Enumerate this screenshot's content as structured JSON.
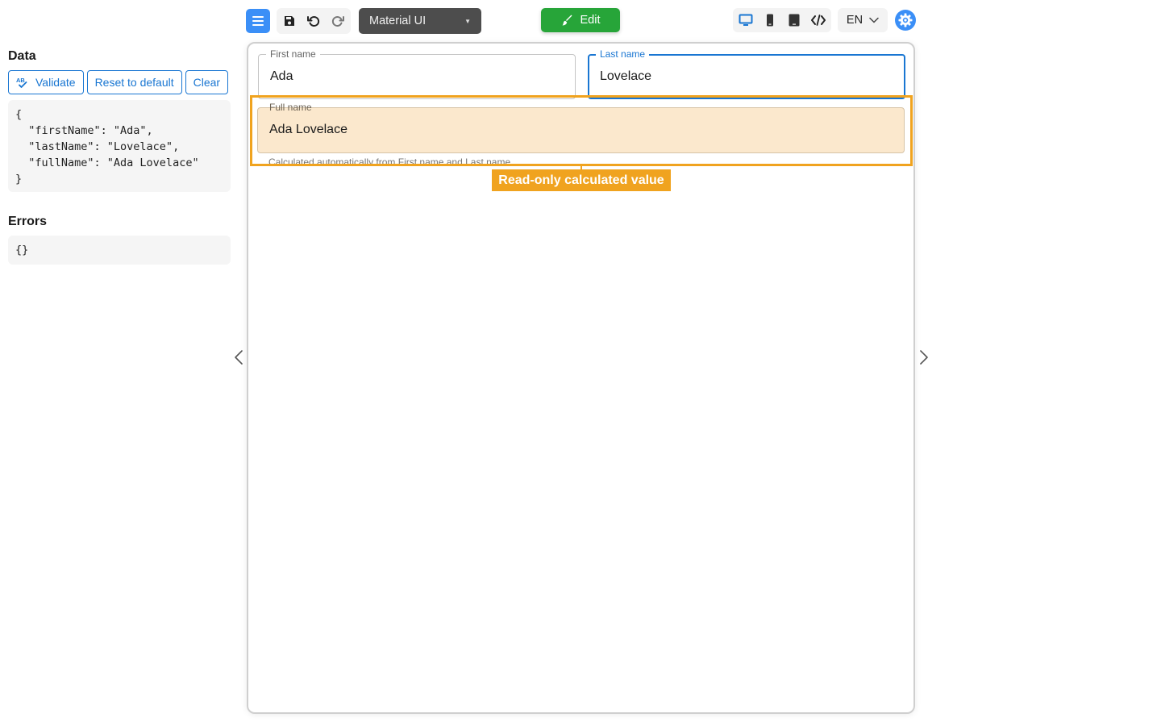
{
  "toolbar": {
    "theme_select_value": "Material UI",
    "edit_label": "Edit",
    "language": "EN"
  },
  "data_panel": {
    "title": "Data",
    "buttons": {
      "validate": "Validate",
      "reset": "Reset to default",
      "clear": "Clear"
    },
    "json_text": "{\n  \"firstName\": \"Ada\",\n  \"lastName\": \"Lovelace\",\n  \"fullName\": \"Ada Lovelace\"\n}"
  },
  "errors_panel": {
    "title": "Errors",
    "json_text": "{}"
  },
  "form": {
    "first_name": {
      "label": "First name",
      "value": "Ada"
    },
    "last_name": {
      "label": "Last name",
      "value": "Lovelace"
    },
    "full_name": {
      "label": "Full name",
      "value": "Ada Lovelace",
      "helper": "Calculated automatically from First name and Last name"
    },
    "annotation": "Read-only calculated value"
  },
  "colors": {
    "accent": "#3b8ff7",
    "primary": "#1976d2",
    "edit_green": "#27a539",
    "highlight_orange": "#f0a31f",
    "readonly_fill": "#fbe8cd"
  },
  "icons": {
    "menu": "hamburger-icon",
    "save": "save-icon",
    "undo": "undo-icon",
    "redo": "redo-icon",
    "edit": "paintbrush-icon",
    "desktop": "desktop-icon",
    "mobile": "mobile-icon",
    "tablet": "tablet-icon",
    "code": "code-icon",
    "settings": "gear-icon"
  }
}
